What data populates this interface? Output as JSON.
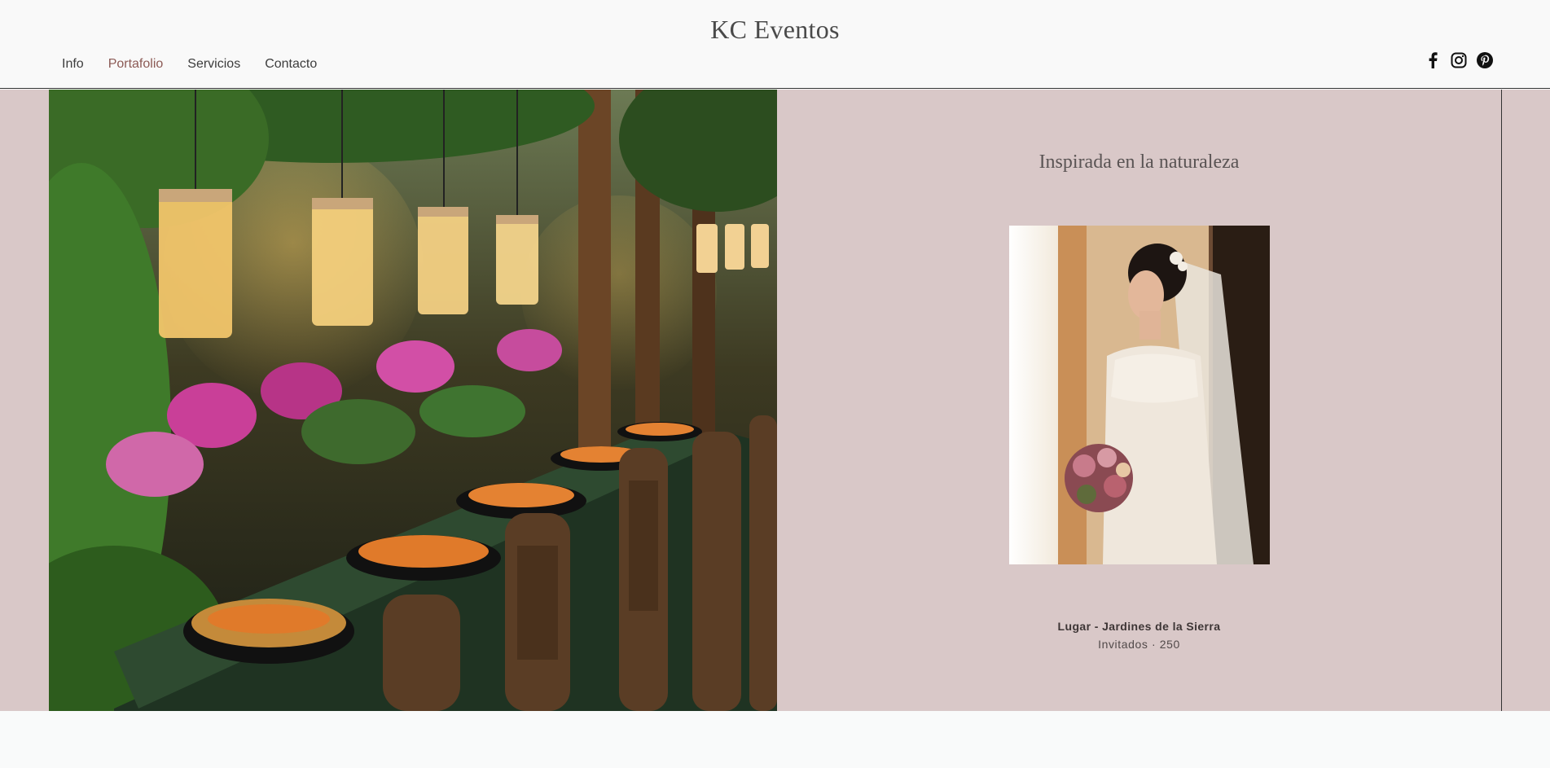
{
  "header": {
    "brand": "KC Eventos",
    "nav": [
      "Info",
      "Portafolio",
      "Servicios",
      "Contacto"
    ],
    "active_nav": "Portafolio",
    "social": [
      "facebook-icon",
      "instagram-icon",
      "pinterest-icon"
    ]
  },
  "portfolio": {
    "title": "Inspirada en la naturaleza",
    "venue": "Lugar - Jardines de la Sierra",
    "guests": "Invitados · 250"
  },
  "colors": {
    "band": "#d9c8c8",
    "active_nav": "#8c5a55",
    "header_bg": "#f9f9f9"
  }
}
